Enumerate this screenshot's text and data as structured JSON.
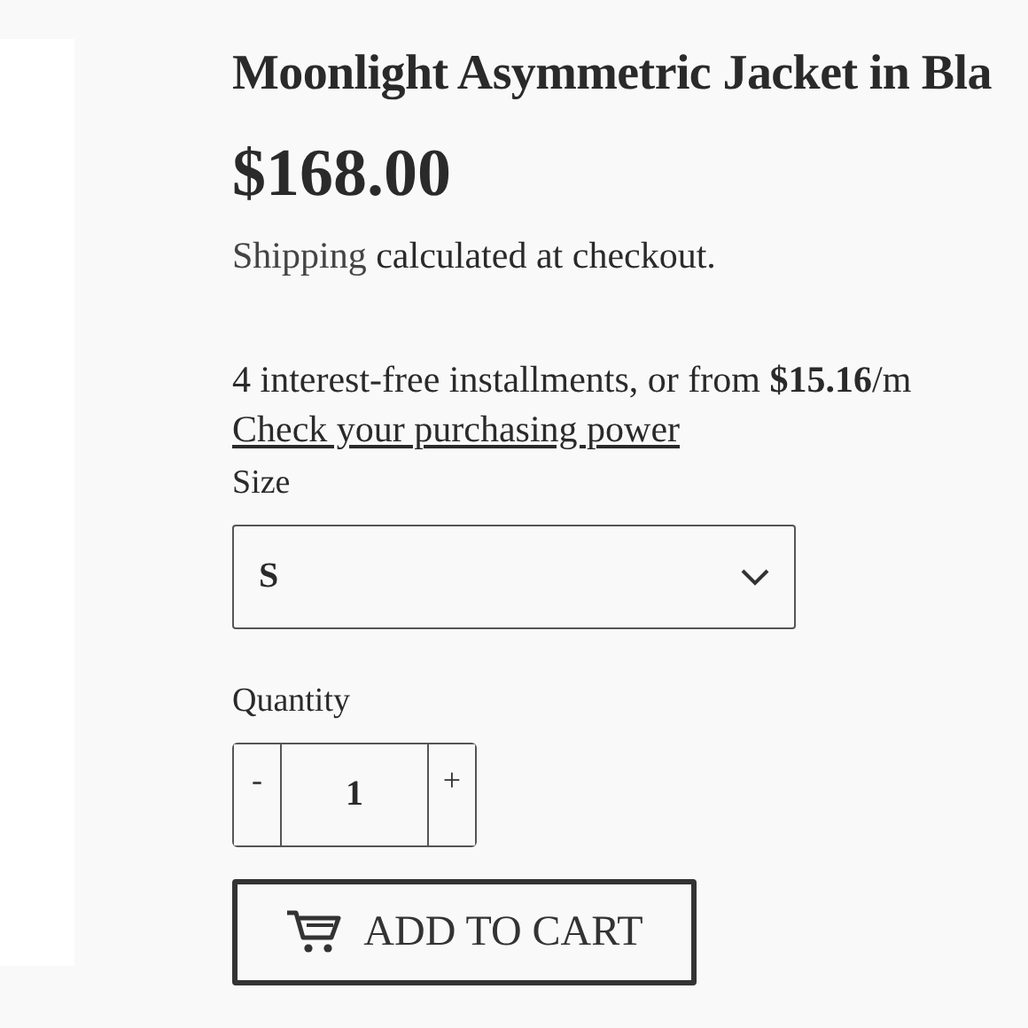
{
  "product": {
    "title": "Moonlight Asymmetric Jacket in Bla",
    "price": "$168.00"
  },
  "shipping": {
    "link": "Shipping",
    "text": "calculated at checkout."
  },
  "installments": {
    "text": "4 interest-free installments, or from **$15.16**/m",
    "link": "Check your purchasing power"
  },
  "size": {
    "label": "Size",
    "value": "S"
  },
  "quantity": {
    "label": "Quantity",
    "minus": "-",
    "value": "1",
    "plus": "+"
  },
  "add_to_cart": {
    "label": "ADD TO CART"
  }
}
